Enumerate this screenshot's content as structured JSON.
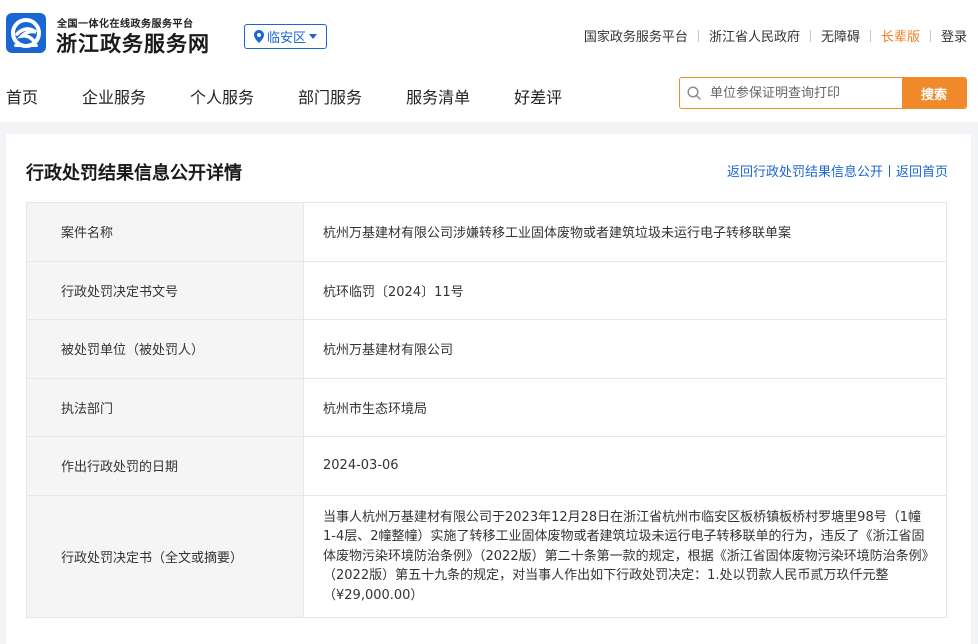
{
  "brand": {
    "subtitle": "全国一体化在线政务服务平台",
    "title": "浙江政务服务网",
    "logo_icon": "zhejiang-gov-logo-icon"
  },
  "region": {
    "label": "临安区",
    "icon": "location-pin-icon",
    "dropdown_icon": "caret-down-icon"
  },
  "toplinks": {
    "national": "国家政务服务平台",
    "province": "浙江省人民政府",
    "accessibility": "无障碍",
    "elder": "长辈版",
    "login": "登录"
  },
  "colors": {
    "primary": "#1a66d2",
    "accent": "#f08a2b",
    "elder": "#f57c1f"
  },
  "nav": [
    "首页",
    "企业服务",
    "个人服务",
    "部门服务",
    "服务清单",
    "好差评"
  ],
  "search": {
    "placeholder": "单位参保证明查询打印",
    "button": "搜索",
    "icon": "search-icon"
  },
  "detail": {
    "title": "行政处罚结果信息公开详情",
    "back_list": "返回行政处罚结果信息公开",
    "back_home": "返回首页",
    "rows": [
      {
        "label": "案件名称",
        "value": "杭州万基建材有限公司涉嫌转移工业固体废物或者建筑垃圾未运行电子转移联单案"
      },
      {
        "label": "行政处罚决定书文号",
        "value": "杭环临罚〔2024〕11号"
      },
      {
        "label": "被处罚单位（被处罚人）",
        "value": "杭州万基建材有限公司"
      },
      {
        "label": "执法部门",
        "value": "杭州市生态环境局"
      },
      {
        "label": "作出行政处罚的日期",
        "value": "2024-03-06"
      },
      {
        "label": "行政处罚决定书（全文或摘要）",
        "value": "当事人杭州万基建材有限公司于2023年12月28日在浙江省杭州市临安区板桥镇板桥村罗塘里98号（1幢1-4层、2幢整幢）实施了转移工业固体废物或者建筑垃圾未运行电子转移联单的行为，违反了《浙江省固体废物污染环境防治条例》（2022版）第二十条第一款的规定，根据《浙江省固体废物污染环境防治条例》（2022版）第五十九条的规定，对当事人作出如下行政处罚决定：1.处以罚款人民币贰万玖仟元整（¥29,000.00）"
      }
    ]
  }
}
